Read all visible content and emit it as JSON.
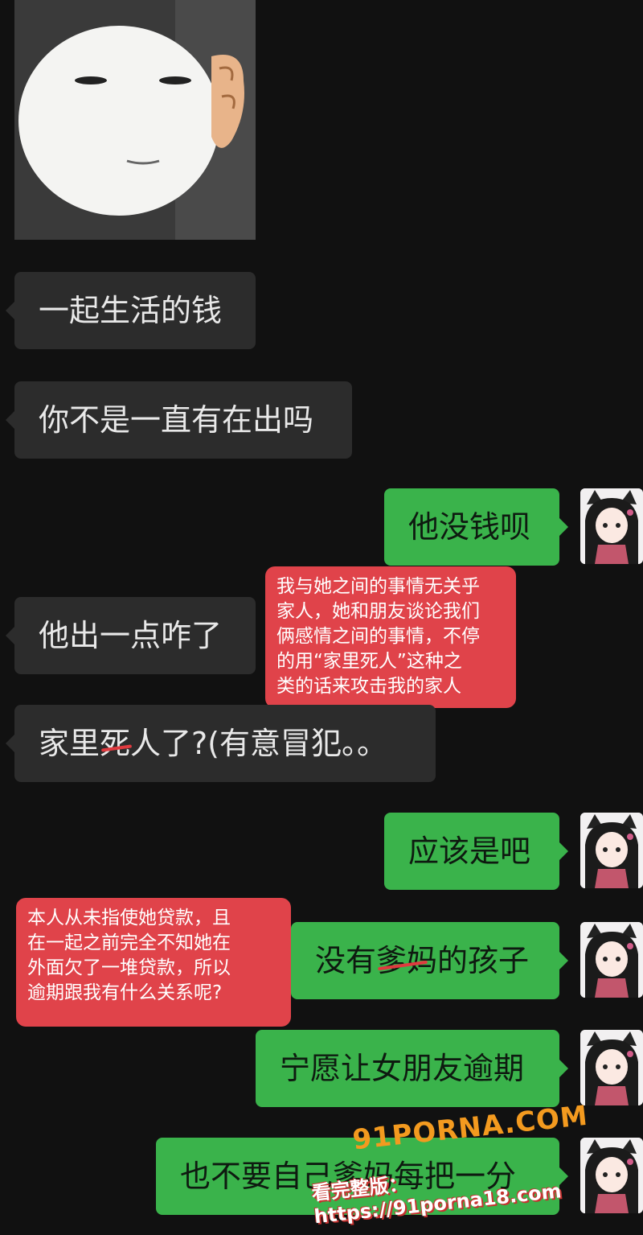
{
  "messages": [
    {
      "side": "left",
      "text": "一起生活的钱"
    },
    {
      "side": "left",
      "text": "你不是一直有在出吗"
    },
    {
      "side": "right",
      "text": "他没钱呗"
    },
    {
      "side": "left",
      "text": "他出一点咋了"
    },
    {
      "side": "left",
      "text": "家里死人了?(有意冒犯。。"
    },
    {
      "side": "right",
      "text": "应该是吧"
    },
    {
      "side": "right",
      "text": "没有爹妈的孩子"
    },
    {
      "side": "right",
      "text": "宁愿让女朋友逾期"
    },
    {
      "side": "right",
      "text": "也不要自己爹妈每把一分"
    }
  ],
  "annotations": [
    {
      "text": "我与她之间的事情无关乎\n家人，她和朋友谈论我们\n俩感情之间的事情，不停\n的用“家里死人”这种之\n类的话来攻击我的家人"
    },
    {
      "text": "本人从未指使她贷款，且\n在一起之前完全不知她在\n外面欠了一堆贷款，所以\n逾期跟我有什么关系呢?"
    }
  ],
  "watermark": {
    "brand": "91PORNA.COM",
    "prefix": "看完整版：",
    "url": "https://91porna18.com"
  },
  "colors": {
    "background": "#111111",
    "left_bubble": "#2c2c2c",
    "right_bubble": "#3ab34b",
    "annotation": "#e0434a",
    "watermark_brand": "#f39a1f"
  },
  "icons": [
    "sticker-face-image",
    "avatar-girl-cat-ears"
  ]
}
